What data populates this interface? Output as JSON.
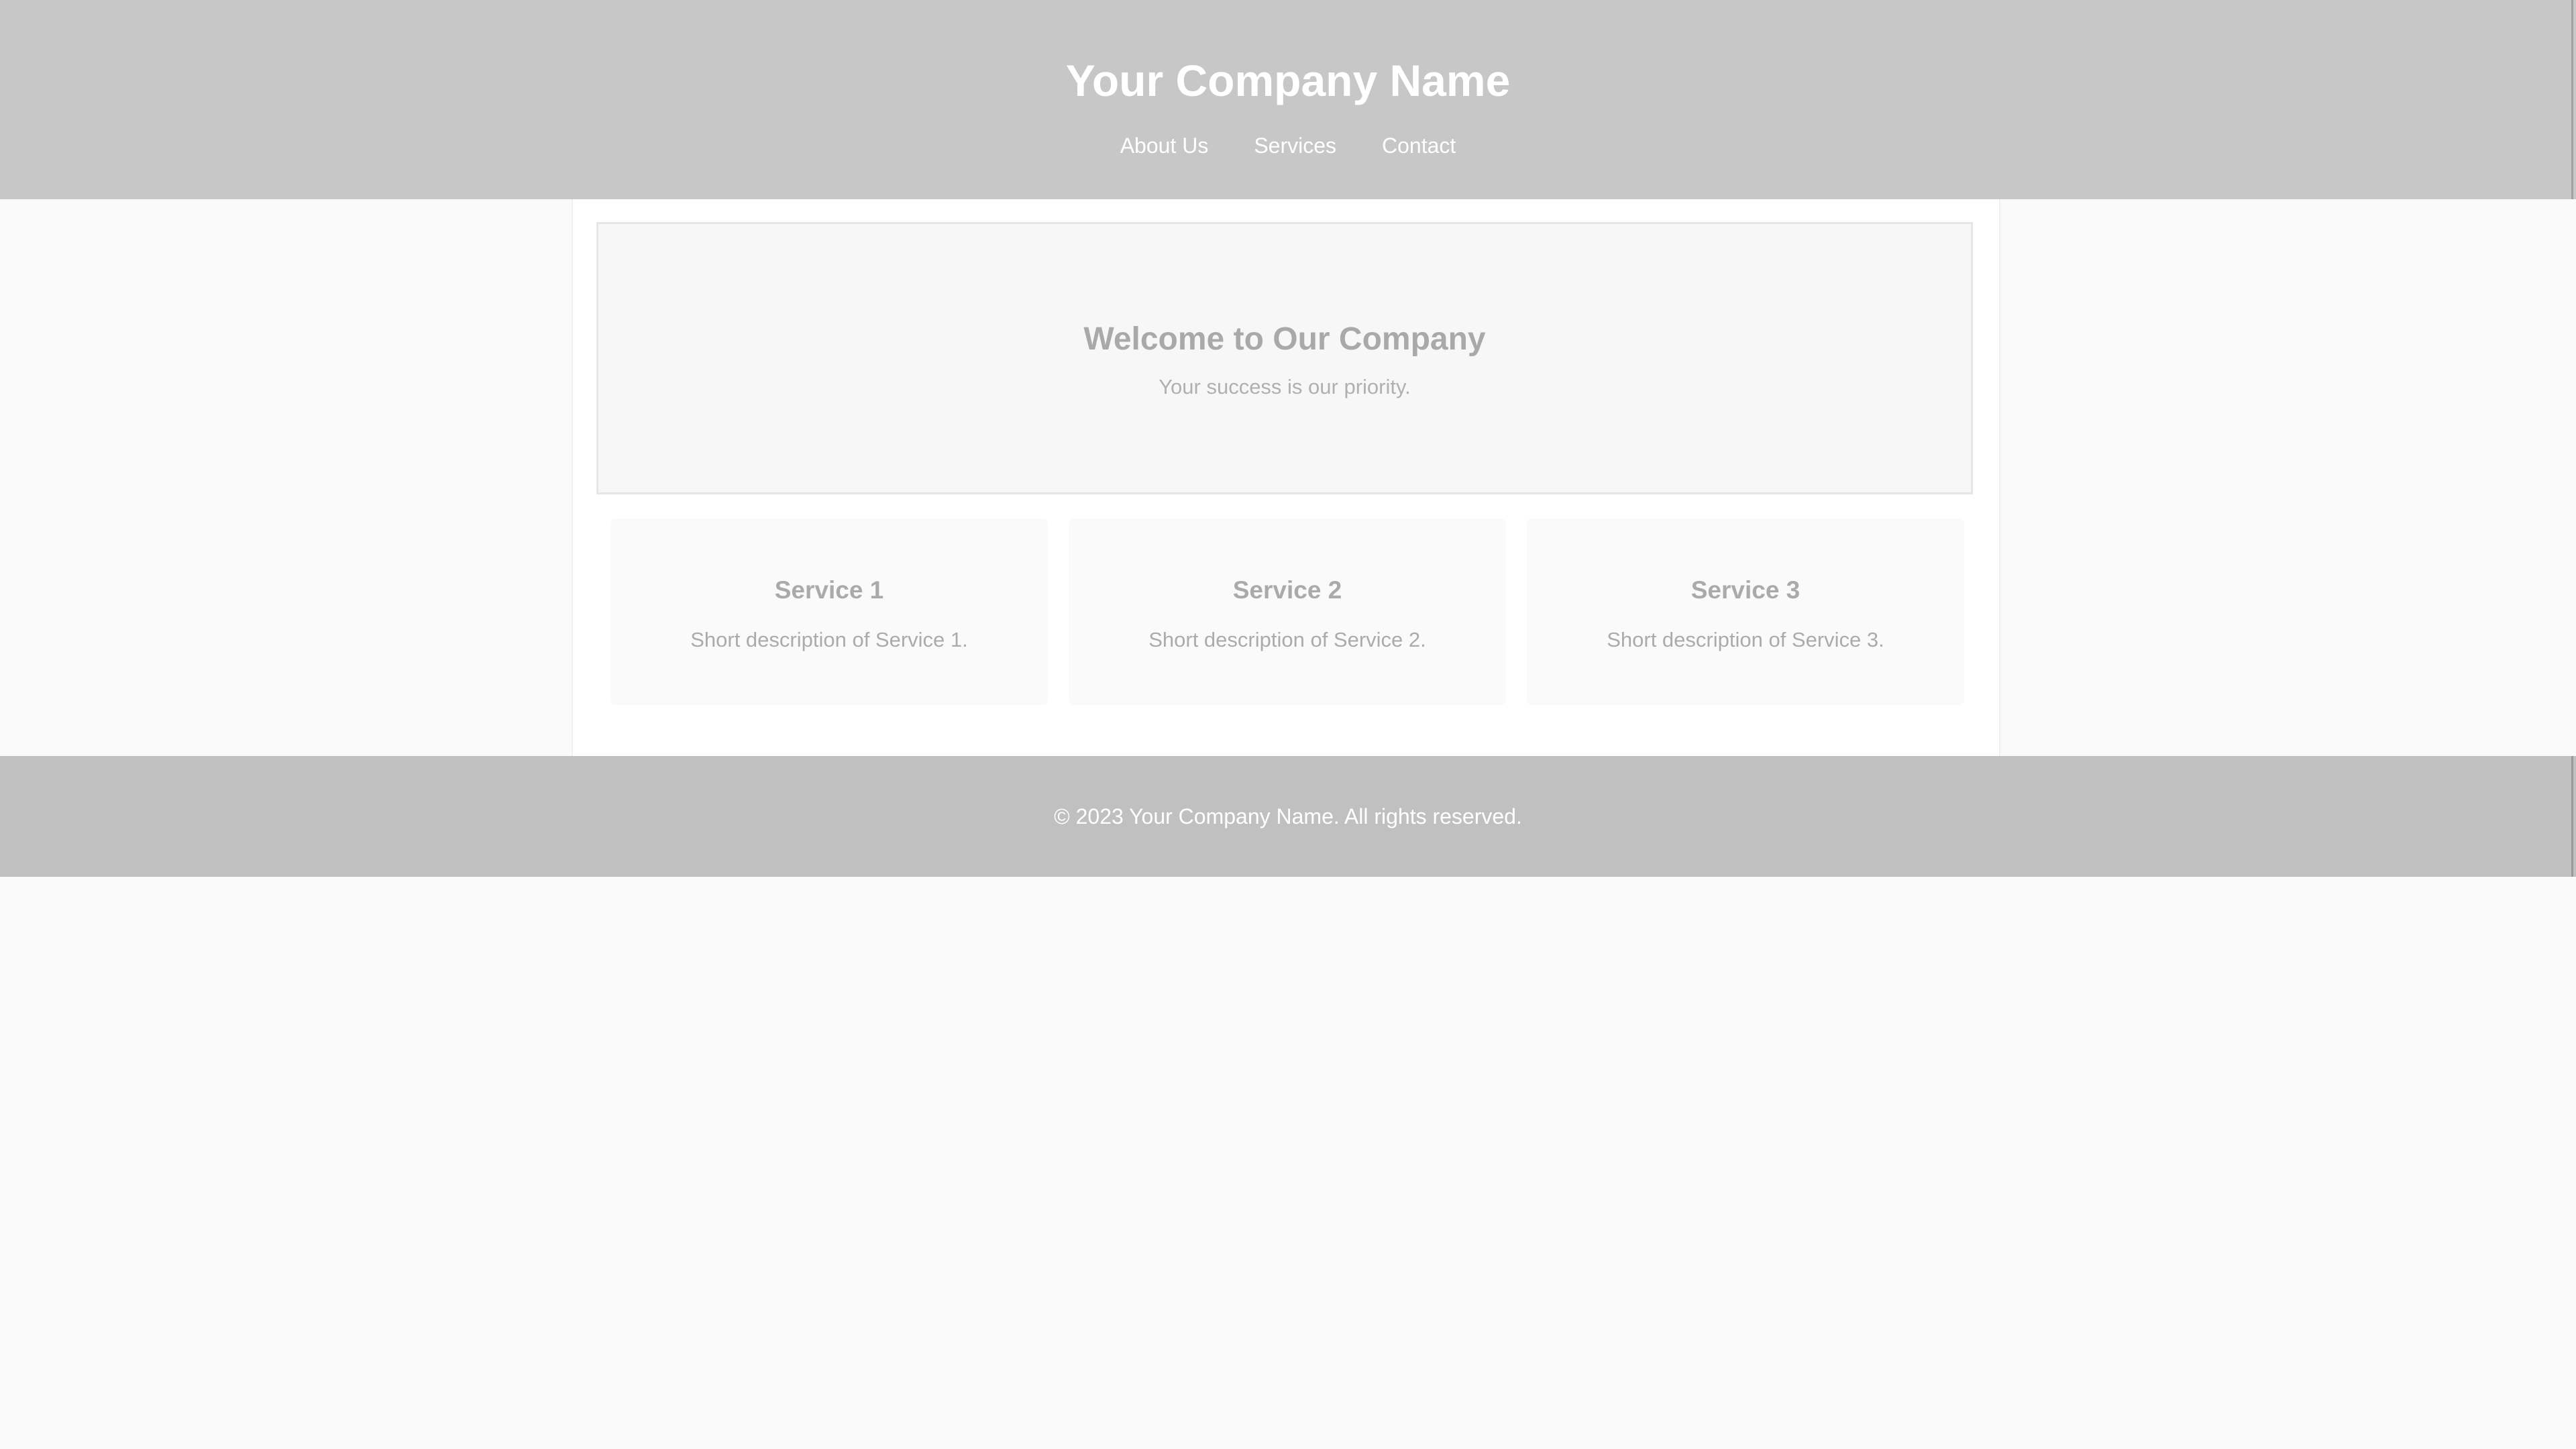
{
  "header": {
    "title": "Your Company Name",
    "nav": [
      {
        "label": "About Us"
      },
      {
        "label": "Services"
      },
      {
        "label": "Contact"
      }
    ]
  },
  "hero": {
    "title": "Welcome to Our Company",
    "subtitle": "Your success is our priority."
  },
  "services": [
    {
      "title": "Service 1",
      "description": "Short description of Service 1."
    },
    {
      "title": "Service 2",
      "description": "Short description of Service 2."
    },
    {
      "title": "Service 3",
      "description": "Short description of Service 3."
    }
  ],
  "footer": {
    "text": "© 2023 Your Company Name. All rights reserved."
  },
  "colors": {
    "header_bg": "#c7c7c7",
    "footer_bg": "#c0c0c0",
    "page_bg": "#fafafa"
  }
}
